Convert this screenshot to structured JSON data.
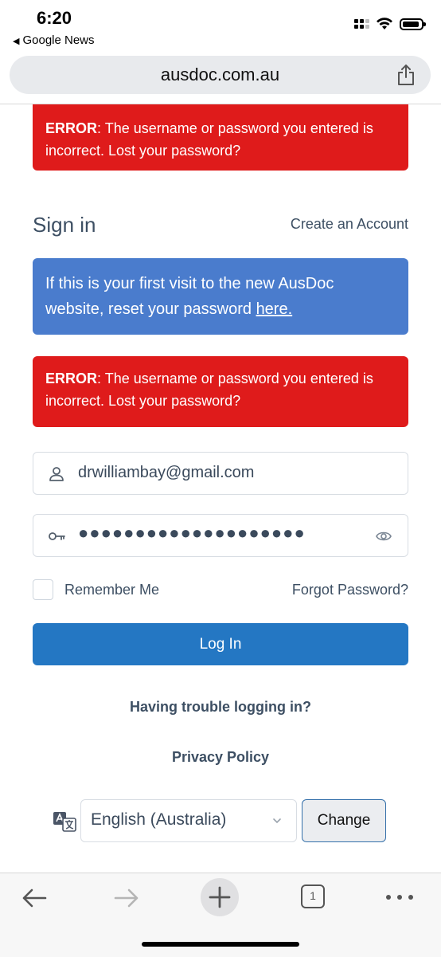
{
  "status_bar": {
    "time": "6:20",
    "back_app": "Google News"
  },
  "browser": {
    "url": "ausdoc.com.au",
    "tab_count": "1"
  },
  "errors": [
    {
      "label": "ERROR",
      "message": ": The username or password you entered is incorrect. Lost your password?"
    },
    {
      "label": "ERROR",
      "message": ": The username or password you entered is incorrect. Lost your password?"
    }
  ],
  "signin": {
    "title": "Sign in",
    "create_account": "Create an Account",
    "info_text": "If this is your first visit to the new AusDoc website, reset your password ",
    "info_link": "here.",
    "username_value": "drwilliambay@gmail.com",
    "password_mask": "●●●●●●●●●●●●●●●●●●●●",
    "remember_label": "Remember Me",
    "forgot_label": "Forgot Password?",
    "login_label": "Log In",
    "trouble_label": "Having trouble logging in?",
    "privacy_label": "Privacy Policy"
  },
  "language": {
    "selected": "English (Australia)",
    "change_label": "Change"
  },
  "colors": {
    "error_bg": "#df1b1b",
    "info_bg": "#4a7ccd",
    "primary_button": "#2477c3",
    "text_muted": "#3d4f63"
  },
  "icons": [
    "back-triangle-icon",
    "cellular-signal-icon",
    "wifi-icon",
    "battery-icon",
    "share-icon",
    "user-icon",
    "key-icon",
    "eye-icon",
    "translate-icon",
    "chevron-down-icon",
    "back-arrow-icon",
    "forward-arrow-icon",
    "plus-icon",
    "tabs-icon",
    "more-icon"
  ]
}
